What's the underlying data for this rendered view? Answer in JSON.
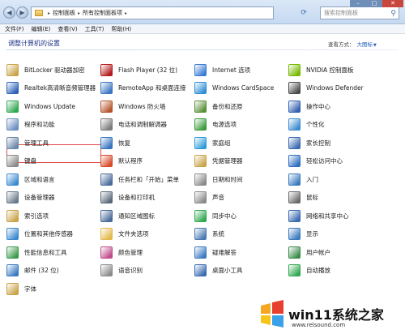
{
  "window": {
    "breadcrumb": [
      "控制面板",
      "所有控制面板项"
    ],
    "search_placeholder": "搜索控制面板"
  },
  "menu": [
    "文件(F)",
    "编辑(E)",
    "查看(V)",
    "工具(T)",
    "帮助(H)"
  ],
  "header": {
    "title": "调整计算机的设置",
    "view_by_label": "查看方式：",
    "view_by_value": "大图标"
  },
  "items": [
    {
      "label": "BitLocker 驱动器加密",
      "icon": "bitlocker-icon",
      "color": "#c9a44a"
    },
    {
      "label": "Flash Player (32 位)",
      "icon": "flash-icon",
      "color": "#b31b1b"
    },
    {
      "label": "Internet 选项",
      "icon": "internet-icon",
      "color": "#3a7bd5"
    },
    {
      "label": "NVIDIA 控制面板",
      "icon": "nvidia-icon",
      "color": "#76b900"
    },
    {
      "label": "Realtek高清晰音频管理器",
      "icon": "realtek-icon",
      "color": "#2d62b8"
    },
    {
      "label": "RemoteApp 和桌面连接",
      "icon": "remoteapp-icon",
      "color": "#3b77c2"
    },
    {
      "label": "Windows CardSpace",
      "icon": "cardspace-icon",
      "color": "#2f8fd6"
    },
    {
      "label": "Windows Defender",
      "icon": "defender-icon",
      "color": "#4a4a4a"
    },
    {
      "label": "Windows Update",
      "icon": "windows-update-icon",
      "color": "#2fa84f"
    },
    {
      "label": "Windows 防火墙",
      "icon": "firewall-icon",
      "color": "#b5532a"
    },
    {
      "label": "备份和还原",
      "icon": "backup-icon",
      "color": "#5b8f3a"
    },
    {
      "label": "操作中心",
      "icon": "action-center-icon",
      "color": "#3361b0"
    },
    {
      "label": "程序和功能",
      "icon": "programs-icon",
      "color": "#6b8fc0"
    },
    {
      "label": "电话和调制解调器",
      "icon": "phone-modem-icon",
      "color": "#7a7a7a"
    },
    {
      "label": "电源选项",
      "icon": "power-icon",
      "color": "#3a9a3a"
    },
    {
      "label": "个性化",
      "icon": "personalization-icon",
      "color": "#3a8bd0"
    },
    {
      "label": "管理工具",
      "icon": "admin-tools-icon",
      "color": "#6a86a8"
    },
    {
      "label": "恢复",
      "icon": "recovery-icon",
      "color": "#3773c0"
    },
    {
      "label": "家庭组",
      "icon": "homegroup-icon",
      "color": "#2f9ad8"
    },
    {
      "label": "家长控制",
      "icon": "parental-icon",
      "color": "#3a6bb0"
    },
    {
      "label": "键盘",
      "icon": "keyboard-icon",
      "color": "#8a8a8a"
    },
    {
      "label": "默认程序",
      "icon": "default-programs-icon",
      "color": "#d84a2a"
    },
    {
      "label": "凭据管理器",
      "icon": "credential-icon",
      "color": "#c9a44a"
    },
    {
      "label": "轻松访问中心",
      "icon": "ease-access-icon",
      "color": "#2f6fc0"
    },
    {
      "label": "区域和语言",
      "icon": "region-icon",
      "color": "#3a8ad0"
    },
    {
      "label": "任务栏和「开始」菜单",
      "icon": "taskbar-icon",
      "color": "#4a6a9a"
    },
    {
      "label": "日期和时间",
      "icon": "datetime-icon",
      "color": "#8a8a8a"
    },
    {
      "label": "入门",
      "icon": "getting-started-icon",
      "color": "#3a7ac0"
    },
    {
      "label": "设备管理器",
      "icon": "device-manager-icon",
      "color": "#6a7a8a"
    },
    {
      "label": "设备和打印机",
      "icon": "printer-icon",
      "color": "#5a6a7a"
    },
    {
      "label": "声音",
      "icon": "sound-icon",
      "color": "#8a8a8a"
    },
    {
      "label": "鼠标",
      "icon": "mouse-icon",
      "color": "#6a6a6a"
    },
    {
      "label": "索引选项",
      "icon": "indexing-icon",
      "color": "#c9a44a"
    },
    {
      "label": "通知区域图标",
      "icon": "notification-icon",
      "color": "#4a6a9a"
    },
    {
      "label": "同步中心",
      "icon": "sync-icon",
      "color": "#2fa84f"
    },
    {
      "label": "网络和共享中心",
      "icon": "network-icon",
      "color": "#3a6ab0"
    },
    {
      "label": "位置和其他传感器",
      "icon": "sensors-icon",
      "color": "#3a8ad0"
    },
    {
      "label": "文件夹选项",
      "icon": "folder-options-icon",
      "color": "#e3b84a"
    },
    {
      "label": "系统",
      "icon": "system-icon",
      "color": "#4a7ab0"
    },
    {
      "label": "显示",
      "icon": "display-icon",
      "color": "#3a7ac0"
    },
    {
      "label": "性能信息和工具",
      "icon": "performance-icon",
      "color": "#3a9a4a"
    },
    {
      "label": "颜色管理",
      "icon": "color-mgmt-icon",
      "color": "#c04a8a"
    },
    {
      "label": "疑难解答",
      "icon": "troubleshoot-icon",
      "color": "#3a7ac0"
    },
    {
      "label": "用户帐户",
      "icon": "user-accounts-icon",
      "color": "#3a8a4a"
    },
    {
      "label": "邮件 (32 位)",
      "icon": "mail-icon",
      "color": "#3a7ac0"
    },
    {
      "label": "语音识别",
      "icon": "speech-icon",
      "color": "#8a8a8a"
    },
    {
      "label": "桌面小工具",
      "icon": "gadgets-icon",
      "color": "#3a6ab0"
    },
    {
      "label": "自动播放",
      "icon": "autoplay-icon",
      "color": "#2fa84f"
    },
    {
      "label": "字体",
      "icon": "fonts-icon",
      "color": "#c9a44a"
    }
  ],
  "watermark": {
    "title": "win11系统之家",
    "url": "www.relsound.com"
  }
}
